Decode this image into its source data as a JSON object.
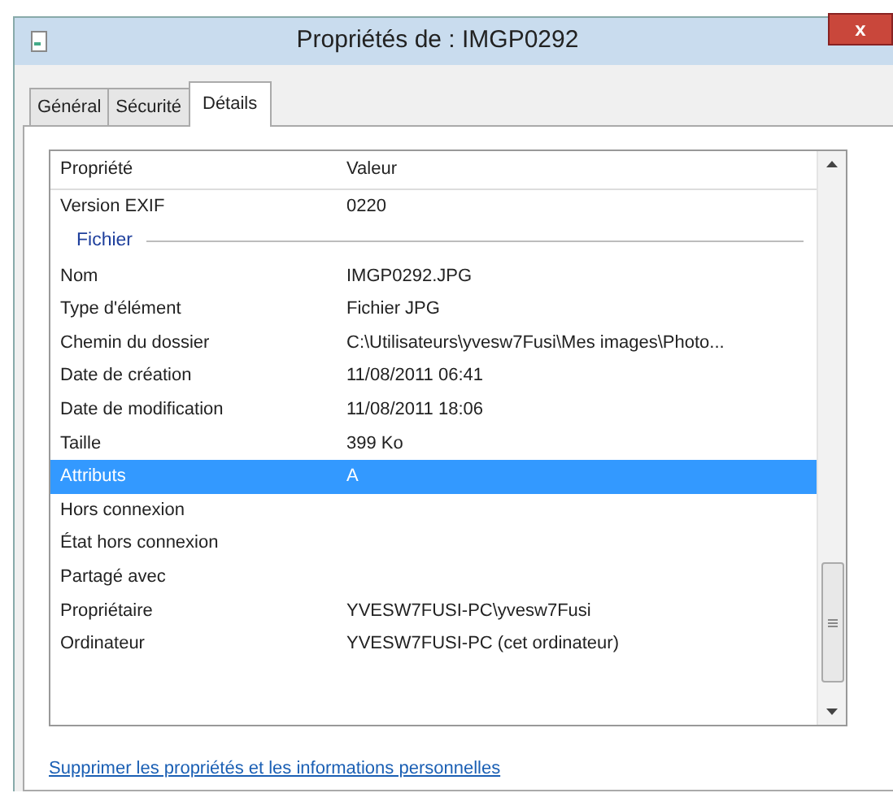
{
  "window": {
    "title": "Propriétés de : IMGP0292",
    "close": "x"
  },
  "tabs": [
    {
      "label": "Général",
      "selected": false
    },
    {
      "label": "Sécurité",
      "selected": false
    },
    {
      "label": "Détails",
      "selected": true
    }
  ],
  "table": {
    "columns": [
      "Propriété",
      "Valeur"
    ],
    "rows": [
      {
        "kind": "row",
        "property": "Version EXIF",
        "value": "0220",
        "selected": false
      },
      {
        "kind": "group",
        "property": "Fichier"
      },
      {
        "kind": "row",
        "property": "Nom",
        "value": "IMGP0292.JPG",
        "selected": false
      },
      {
        "kind": "row",
        "property": "Type d'élément",
        "value": "Fichier JPG",
        "selected": false
      },
      {
        "kind": "row",
        "property": "Chemin du dossier",
        "value": "C:\\Utilisateurs\\yvesw7Fusi\\Mes images\\Photo...",
        "selected": false
      },
      {
        "kind": "row",
        "property": "Date de création",
        "value": "11/08/2011 06:41",
        "selected": false
      },
      {
        "kind": "row",
        "property": "Date de modification",
        "value": "11/08/2011 18:06",
        "selected": false
      },
      {
        "kind": "row",
        "property": "Taille",
        "value": "399 Ko",
        "selected": false
      },
      {
        "kind": "row",
        "property": "Attributs",
        "value": "A",
        "selected": true
      },
      {
        "kind": "row",
        "property": "Hors connexion",
        "value": "",
        "selected": false
      },
      {
        "kind": "row",
        "property": "État hors connexion",
        "value": "",
        "selected": false
      },
      {
        "kind": "row",
        "property": "Partagé avec",
        "value": "",
        "selected": false
      },
      {
        "kind": "row",
        "property": "Propriétaire",
        "value": "YVESW7FUSI-PC\\yvesw7Fusi",
        "selected": false
      },
      {
        "kind": "row",
        "property": "Ordinateur",
        "value": "YVESW7FUSI-PC (cet ordinateur)",
        "selected": false
      }
    ]
  },
  "link": "Supprimer les propriétés et les informations personnelles"
}
